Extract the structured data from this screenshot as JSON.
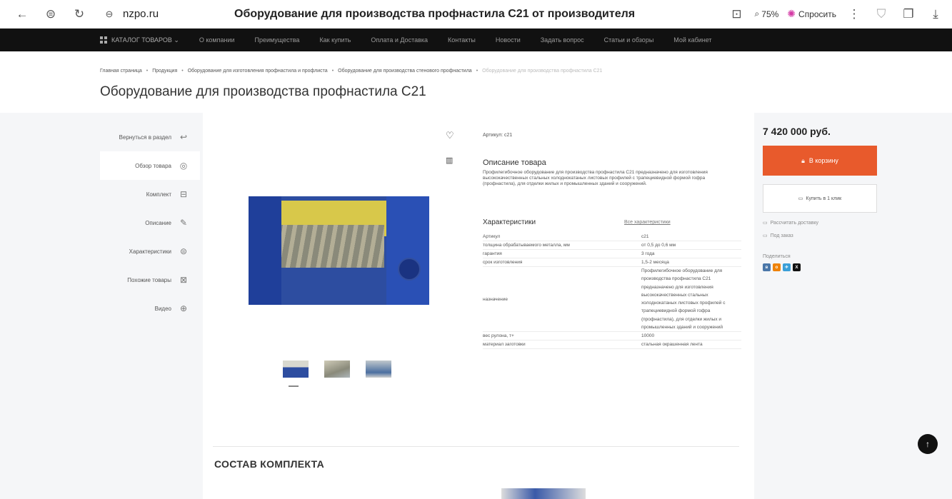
{
  "browser": {
    "back": "←",
    "shield": "⊜",
    "reload": "↻",
    "lock": "🔒",
    "domain": "nzpo.ru",
    "title": "Оборудование для производства профнастила С21 от производителя",
    "zoom": "75%",
    "ask_label": "Спросить",
    "icons": [
      "bookmark-icon",
      "zoom-icon",
      "menu-dots-icon",
      "shield-ext-icon",
      "collections-icon",
      "download-icon"
    ]
  },
  "nav": {
    "catalog": "КАТАЛОГ ТОВАРОВ ⌄",
    "items": [
      "О компании",
      "Преимущества",
      "Как купить",
      "Оплата и Доставка",
      "Контакты",
      "Новости",
      "Задать вопрос",
      "Статьи и обзоры",
      "Мой кабинет"
    ]
  },
  "breadcrumb": {
    "items": [
      "Главная страница",
      "Продукция",
      "Оборудование для изготовления профнастила и профлиста",
      "Оборудование для производства стенового профнастила"
    ],
    "current": "Оборудование для производства профнастила С21"
  },
  "heading": "Оборудование для производства профнастила С21",
  "sidebar": {
    "items": [
      {
        "label": "Вернуться в раздел",
        "icon": "↩"
      },
      {
        "label": "Обзор товара",
        "icon": "◎"
      },
      {
        "label": "Комплект",
        "icon": "⊟"
      },
      {
        "label": "Описание",
        "icon": "✎"
      },
      {
        "label": "Характеристики",
        "icon": "⊜"
      },
      {
        "label": "Похожие товары",
        "icon": "⊠"
      },
      {
        "label": "Видео",
        "icon": "⊕"
      }
    ]
  },
  "product": {
    "fav_icon": "♡",
    "compare_icon": "▥",
    "sku_line": "Артикул: с21",
    "desc_title": "Описание товара",
    "desc_text": "Профилегибочное оборудование для производства профнастила С21 предназначено для изготовления высококачественных стальных холоднокатаных листовых профилей с трапециевидной формой гофра (профнастила), для отделки жилых и промышленных зданий и сооружений.",
    "char_title": "Характеристики",
    "char_link": "Все характеристики",
    "specs": [
      {
        "k": "Артикул",
        "v": "с21"
      },
      {
        "k": "толщина обрабатываемого металла, мм",
        "v": "от 0,5 до 0,6 мм"
      },
      {
        "k": "гарантия",
        "v": "3 года"
      },
      {
        "k": "срок изготовления",
        "v": "1,5-2 месяца"
      },
      {
        "k": "назначение",
        "v": "Профилегибочное оборудование для производства профнастила С21 предназначено для изготовления высококачественных стальных холоднокатаных листовых профилей с трапециевидной формой гофра (профнастила), для отделки жилых и промышленных зданий и сооружений"
      },
      {
        "k": "вес рулона, т+",
        "v": "10000"
      },
      {
        "k": "материал заготовки",
        "v": "стальная окрашенная лента"
      }
    ],
    "kit_title": "СОСТАВ КОМПЛЕКТА"
  },
  "buy": {
    "price": "7 420 000 руб.",
    "cart_label": "В корзину",
    "oneclick_label": "Купить в 1 клик",
    "delivery_link": "Рассчитать доставку",
    "preorder_link": "Под заказ",
    "share_label": "Поделиться",
    "socials": [
      "vk",
      "ok",
      "tg",
      "x"
    ]
  }
}
